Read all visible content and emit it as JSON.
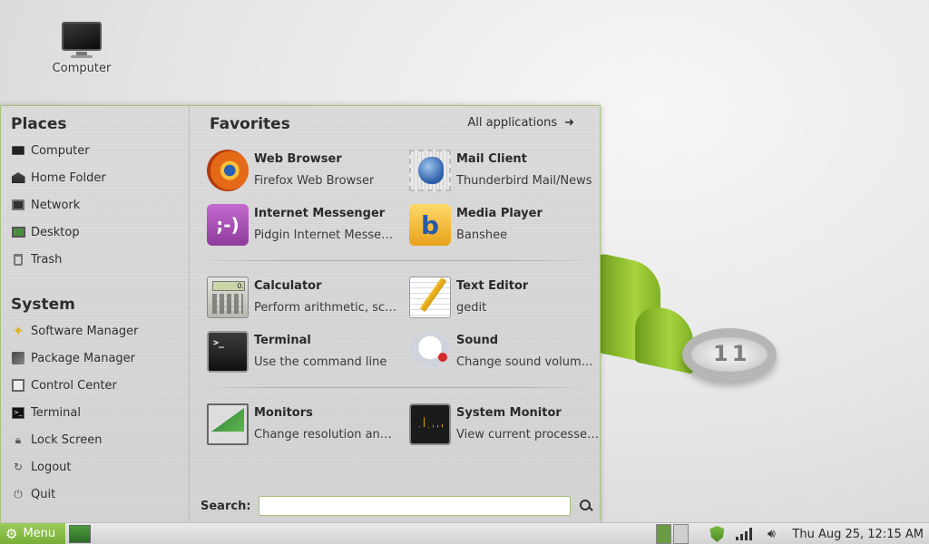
{
  "desktop": {
    "icons": [
      {
        "label": "Computer",
        "icon": "computer-icon"
      }
    ]
  },
  "menu": {
    "places": {
      "title": "Places",
      "items": [
        {
          "label": "Computer",
          "icon": "computer-icon"
        },
        {
          "label": "Home Folder",
          "icon": "home-folder-icon"
        },
        {
          "label": "Network",
          "icon": "network-icon"
        },
        {
          "label": "Desktop",
          "icon": "desktop-icon"
        },
        {
          "label": "Trash",
          "icon": "trash-icon"
        }
      ]
    },
    "system": {
      "title": "System",
      "items": [
        {
          "label": "Software Manager",
          "icon": "software-manager-icon"
        },
        {
          "label": "Package Manager",
          "icon": "package-manager-icon"
        },
        {
          "label": "Control Center",
          "icon": "control-center-icon"
        },
        {
          "label": "Terminal",
          "icon": "terminal-icon"
        },
        {
          "label": "Lock Screen",
          "icon": "lock-icon"
        },
        {
          "label": "Logout",
          "icon": "logout-icon"
        },
        {
          "label": "Quit",
          "icon": "power-icon"
        }
      ]
    },
    "favorites": {
      "title": "Favorites",
      "all_applications": "All applications",
      "apps": [
        {
          "name": "Web Browser",
          "desc": "Firefox Web Browser",
          "icon": "firefox-icon"
        },
        {
          "name": "Mail Client",
          "desc": "Thunderbird Mail/News",
          "icon": "thunderbird-icon"
        },
        {
          "name": "Internet Messenger",
          "desc": "Pidgin Internet Messen…",
          "icon": "pidgin-icon"
        },
        {
          "name": "Media Player",
          "desc": "Banshee",
          "icon": "banshee-icon"
        },
        {
          "name": "Calculator",
          "desc": "Perform arithmetic, sci…",
          "icon": "calculator-icon"
        },
        {
          "name": "Text Editor",
          "desc": "gedit",
          "icon": "text-editor-icon"
        },
        {
          "name": "Terminal",
          "desc": "Use the command line",
          "icon": "terminal-icon"
        },
        {
          "name": "Sound",
          "desc": "Change sound volume …",
          "icon": "sound-icon"
        },
        {
          "name": "Monitors",
          "desc": "Change resolution and …",
          "icon": "monitors-icon"
        },
        {
          "name": "System Monitor",
          "desc": "View current processes…",
          "icon": "system-monitor-icon"
        }
      ]
    },
    "search": {
      "label": "Search:",
      "value": "",
      "placeholder": ""
    }
  },
  "panel": {
    "menu_label": "Menu",
    "clock": "Thu Aug 25, 12:15 AM",
    "colors": {
      "accent": "#87bc46",
      "panel": "#dcdcdc"
    }
  }
}
